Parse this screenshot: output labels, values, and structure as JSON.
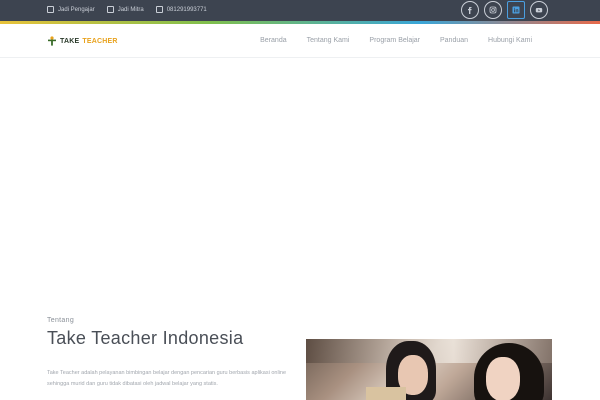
{
  "topbar": {
    "links": [
      {
        "label": "Jadi Pengajar",
        "icon": "checkbox-icon"
      },
      {
        "label": "Jadi Mitra",
        "icon": "checkbox-icon"
      },
      {
        "label": "081291993771",
        "icon": "checkbox-icon"
      }
    ],
    "socials": [
      "facebook-icon",
      "instagram-icon",
      "linkedin-icon",
      "youtube-icon"
    ]
  },
  "brand": {
    "take": "TAKE",
    "teacher": "TEACHER",
    "accent": "#e8a21d"
  },
  "nav": {
    "items": [
      "Beranda",
      "Tentang Kami",
      "Program Belajar",
      "Panduan",
      "Hubungi Kami"
    ]
  },
  "about": {
    "kicker": "Tentang",
    "title": "Take Teacher Indonesia",
    "body": "Take Teacher adalah pelayanan bimbingan belajar dengan pencarian guru berbasis aplikasi online sehingga murid dan guru tidak dibatasi oleh jadwal belajar yang statis."
  },
  "colors": {
    "topbar_bg": "#3d4450",
    "title": "#4a4f57",
    "nav_text": "#9aa0a8"
  }
}
